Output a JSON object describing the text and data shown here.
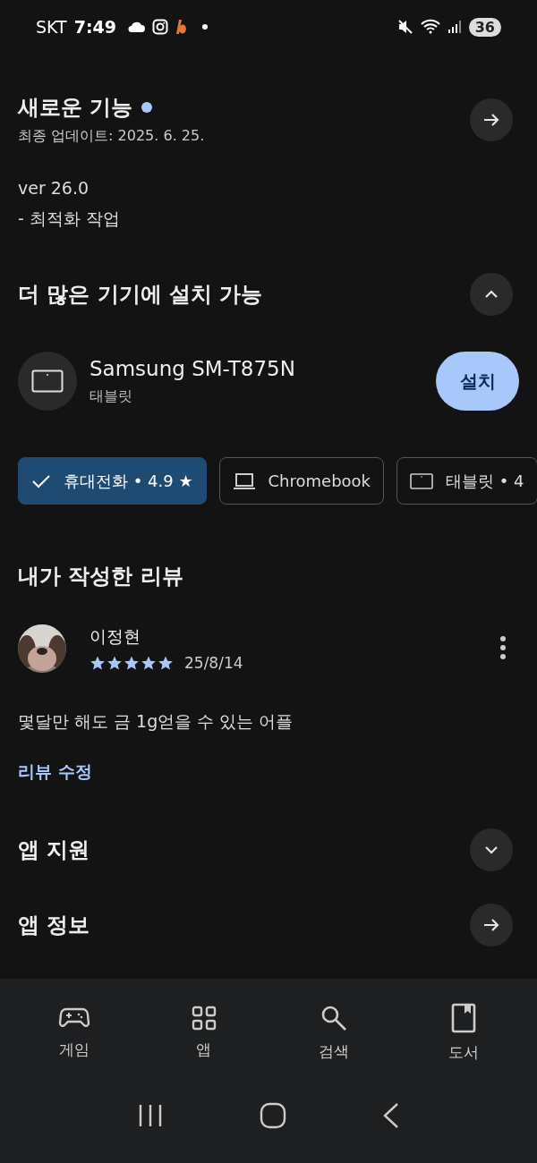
{
  "status_bar": {
    "carrier": "SKT",
    "time": "7:49",
    "battery": "36"
  },
  "whats_new": {
    "title": "새로운 기능",
    "unread": true,
    "updated": "최종 업데이트: 2025. 6. 25.",
    "notes": [
      "ver 26.0",
      "- 최적화 작업"
    ]
  },
  "devices": {
    "title": "더 많은 기기에 설치 가능",
    "expanded": true,
    "device": {
      "name": "Samsung SM-T875N",
      "type": "태블릿",
      "button": "설치"
    }
  },
  "device_chips": [
    {
      "label": "휴대전화 • 4.9 ★",
      "selected": true
    },
    {
      "kind": "laptop",
      "label": "Chromebook",
      "selected": false
    },
    {
      "kind": "tablet",
      "label": "태블릿 • 4",
      "selected": false
    }
  ],
  "my_review": {
    "title": "내가 작성한 리뷰",
    "author": "이정현",
    "stars": 5,
    "date": "25/8/14",
    "text": "몇달만 해도 금 1g얻을 수 있는 어플",
    "edit_link": "리뷰 수정"
  },
  "app_support": {
    "title": "앱 지원",
    "expanded": false
  },
  "app_info": {
    "title": "앱 정보"
  },
  "bottom_nav": [
    {
      "kind": "games",
      "label": "게임",
      "selected": false
    },
    {
      "kind": "apps",
      "label": "앱",
      "selected": false
    },
    {
      "kind": "search",
      "label": "검색",
      "selected": false
    },
    {
      "kind": "books",
      "label": "도서",
      "selected": false
    }
  ]
}
